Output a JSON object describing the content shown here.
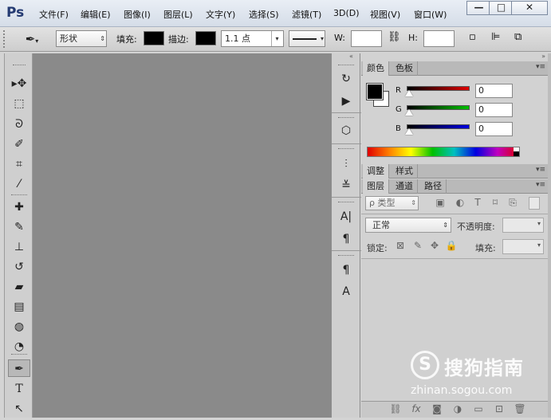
{
  "app": {
    "logo": "Ps"
  },
  "menu": [
    "文件(F)",
    "编辑(E)",
    "图像(I)",
    "图层(L)",
    "文字(Y)",
    "选择(S)",
    "滤镜(T)",
    "3D(D)",
    "视图(V)",
    "窗口(W)"
  ],
  "window_controls": {
    "minimize": "—",
    "maximize": "□",
    "close": "✕"
  },
  "options": {
    "mode_select": "形状",
    "fill_label": "填充:",
    "stroke_label": "描边:",
    "stroke_width": "1.1 点",
    "w_label": "W:",
    "h_label": "H:",
    "fill_color": "#000000",
    "stroke_color": "#000000"
  },
  "tools": [
    {
      "name": "move-tool-icon",
      "glyph": "▸✥"
    },
    {
      "name": "marquee-tool-icon",
      "glyph": "⬚"
    },
    {
      "name": "lasso-tool-icon",
      "glyph": "ᘐ"
    },
    {
      "name": "quick-select-tool-icon",
      "glyph": "✐"
    },
    {
      "name": "crop-tool-icon",
      "glyph": "⌗"
    },
    {
      "name": "eyedropper-tool-icon",
      "glyph": "⁄"
    },
    {
      "name": "healing-brush-tool-icon",
      "glyph": "✚"
    },
    {
      "name": "brush-tool-icon",
      "glyph": "✎"
    },
    {
      "name": "stamp-tool-icon",
      "glyph": "⊥"
    },
    {
      "name": "history-brush-tool-icon",
      "glyph": "↺"
    },
    {
      "name": "eraser-tool-icon",
      "glyph": "▰"
    },
    {
      "name": "gradient-tool-icon",
      "glyph": "▤"
    },
    {
      "name": "blur-tool-icon",
      "glyph": "◍"
    },
    {
      "name": "dodge-tool-icon",
      "glyph": "◔"
    },
    {
      "name": "pen-tool-icon",
      "glyph": "✒"
    },
    {
      "name": "type-tool-icon",
      "glyph": "T"
    },
    {
      "name": "path-select-tool-icon",
      "glyph": "↖"
    }
  ],
  "dock_icons": [
    {
      "name": "history-panel-icon",
      "glyph": "↻"
    },
    {
      "name": "actions-panel-icon",
      "glyph": "▶"
    },
    {
      "name": "3d-panel-icon",
      "glyph": "⬡"
    },
    {
      "name": "brush-panel-icon",
      "glyph": "⫶"
    },
    {
      "name": "brush-presets-panel-icon",
      "glyph": "≚"
    },
    {
      "name": "character-panel-icon",
      "glyph": "A|"
    },
    {
      "name": "paragraph-panel-icon",
      "glyph": "¶"
    },
    {
      "name": "paragraph-styles-panel-icon",
      "glyph": "¶"
    },
    {
      "name": "character-styles-panel-icon",
      "glyph": "A"
    }
  ],
  "color_panel": {
    "tabs": [
      "颜色",
      "色板"
    ],
    "channels": [
      {
        "label": "R",
        "value": "0",
        "color": "#e00000"
      },
      {
        "label": "G",
        "value": "0",
        "color": "#00c000"
      },
      {
        "label": "B",
        "value": "0",
        "color": "#0000e0"
      }
    ],
    "foreground": "#000000",
    "background": "#ffffff"
  },
  "adjust_panel": {
    "tabs": [
      "调整",
      "样式"
    ]
  },
  "layers_panel": {
    "tabs": [
      "图层",
      "通道",
      "路径"
    ],
    "filter_label": "ρ 类型",
    "blend_mode": "正常",
    "opacity_label": "不透明度:",
    "lock_label": "锁定:",
    "fill_label": "填充:"
  },
  "watermark": {
    "brand": "搜狗指南",
    "url": "zhinan.sogou.com"
  }
}
